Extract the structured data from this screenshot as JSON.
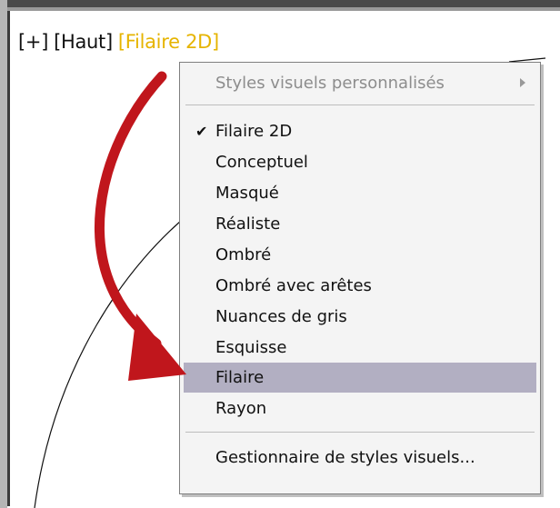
{
  "viewport": {
    "controls": {
      "plus": "[+]",
      "view": "[Haut]",
      "visual_style_label": "[Filaire 2D]"
    }
  },
  "menu": {
    "submenu_item": "Styles visuels personnalisés",
    "items": [
      {
        "label": "Filaire 2D",
        "checked": true
      },
      {
        "label": "Conceptuel"
      },
      {
        "label": "Masqué"
      },
      {
        "label": "Réaliste"
      },
      {
        "label": "Ombré"
      },
      {
        "label": "Ombré avec arêtes"
      },
      {
        "label": "Nuances de gris"
      },
      {
        "label": "Esquisse"
      },
      {
        "label": "Filaire",
        "highlighted": true
      },
      {
        "label": "Rayon"
      }
    ],
    "footer_item": "Gestionnaire de styles visuels...",
    "check_glyph": "✔"
  },
  "colors": {
    "active_style": "#e6b400",
    "highlight": "#b2afc2",
    "arrow": "#c0161c"
  }
}
